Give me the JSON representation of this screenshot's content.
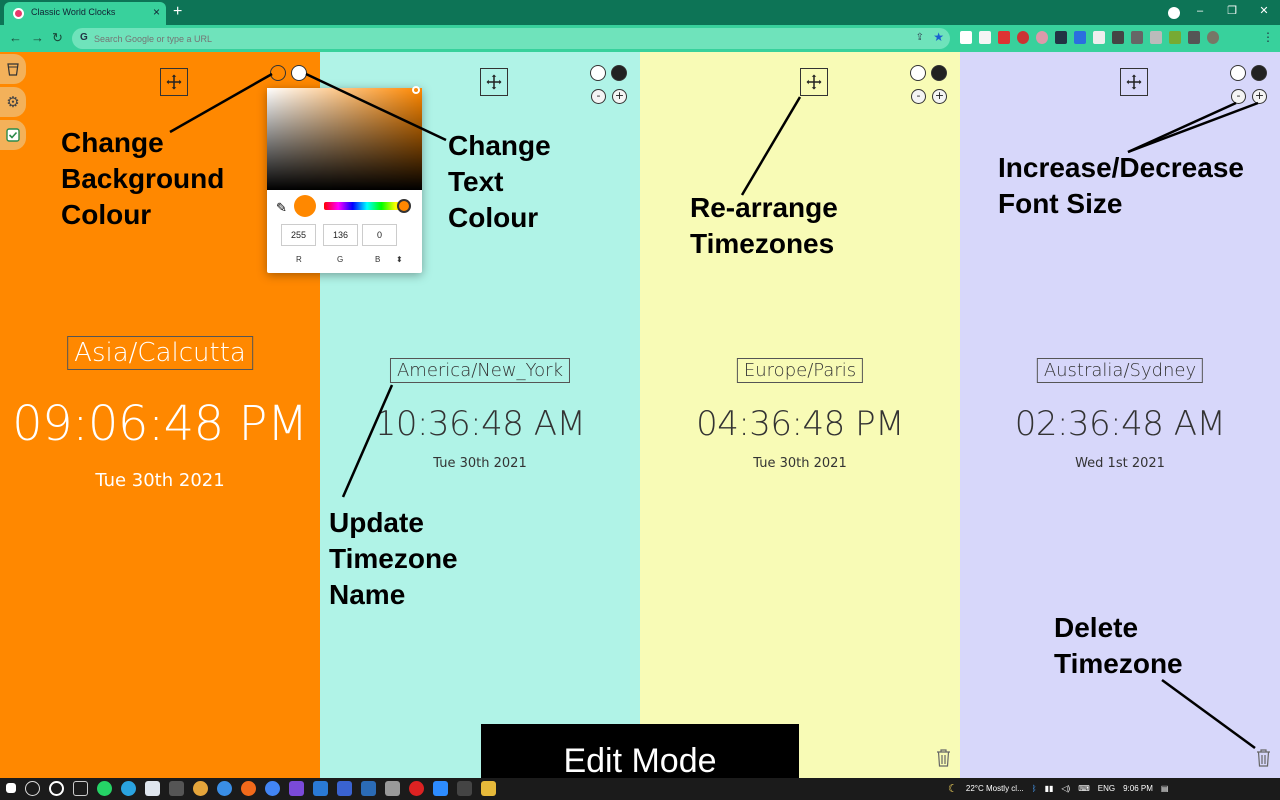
{
  "browser": {
    "tab_title": "Classic World Clocks",
    "tab_close": "×",
    "new_tab": "+",
    "omnibox_placeholder": "Search Google or type a URL",
    "omnibox_icon": "G",
    "menu": "⋮",
    "window_controls": [
      "–",
      "❐",
      "✕"
    ]
  },
  "clocks": [
    {
      "timezone": "Asia/Calcutta",
      "time": "09:06:48 PM",
      "date": "Tue 30th 2021",
      "background": "#ff8800",
      "text_color": "#ffffff"
    },
    {
      "timezone": "America/New_York",
      "time": "10:36:48 AM",
      "date": "Tue 30th 2021",
      "background": "#b0f3e7",
      "text_color": "#333333"
    },
    {
      "timezone": "Europe/Paris",
      "time": "04:36:48 PM",
      "date": "Tue 30th 2021",
      "background": "#f8fbb6",
      "text_color": "#333333"
    },
    {
      "timezone": "Australia/Sydney",
      "time": "02:36:48 AM",
      "date": "Wed 1st 2021",
      "background": "#d7d7fa",
      "text_color": "#333333"
    }
  ],
  "font_controls": {
    "decrease": "-",
    "increase": "+"
  },
  "color_picker": {
    "color": "#ff8800",
    "r": "255",
    "g": "136",
    "b": "0",
    "r_label": "R",
    "g_label": "G",
    "b_label": "B",
    "mode_toggle": "⬍"
  },
  "annotations": {
    "bg_colour": [
      "Change",
      "Background",
      "Colour"
    ],
    "text_colour": [
      "Change",
      "Text",
      "Colour"
    ],
    "rearrange": [
      "Re-arrange",
      "Timezones"
    ],
    "font_size": [
      "Increase/Decrease",
      "Font Size"
    ],
    "update_name": [
      "Update",
      "Timezone",
      "Name"
    ],
    "delete": [
      "Delete",
      "Timezone"
    ]
  },
  "edit_mode_label": "Edit Mode",
  "taskbar": {
    "weather": "22°C  Mostly cl...",
    "language": "ENG",
    "clock": "9:06 PM"
  }
}
